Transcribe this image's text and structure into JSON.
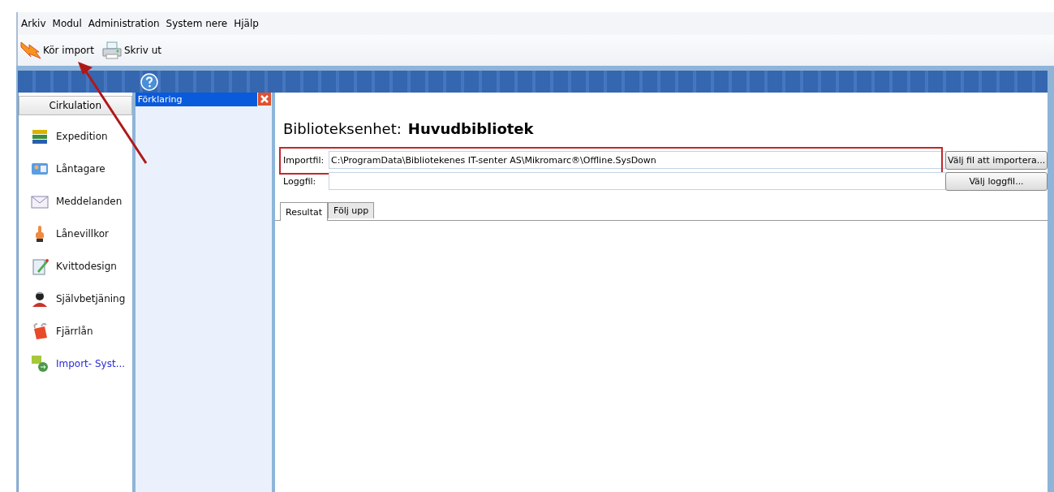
{
  "menu": [
    "Arkiv",
    "Modul",
    "Administration",
    "System nere",
    "Hjälp"
  ],
  "toolbar": [
    {
      "label": "Kör import",
      "kind": "run"
    },
    {
      "label": "Skriv ut",
      "kind": "print"
    }
  ],
  "sidebar": {
    "title": "Cirkulation",
    "items": [
      {
        "label": "Expedition",
        "kind": "books",
        "selected": false
      },
      {
        "label": "Låntagare",
        "kind": "card",
        "selected": false
      },
      {
        "label": "Meddelanden",
        "kind": "mail",
        "selected": false
      },
      {
        "label": "Lånevillkor",
        "kind": "finger",
        "selected": false
      },
      {
        "label": "Kvittodesign",
        "kind": "pen",
        "selected": false
      },
      {
        "label": "Självbetjäning",
        "kind": "person",
        "selected": false
      },
      {
        "label": "Fjärrlån",
        "kind": "bag",
        "selected": false
      },
      {
        "label": "Import- Syst...",
        "kind": "import",
        "selected": true
      }
    ]
  },
  "help_panel": {
    "title": "Förklaring"
  },
  "main": {
    "unit_label": "Biblioteksenhet:",
    "unit_value": "Huvudbibliotek",
    "fields": [
      {
        "label": "Importfil:",
        "value": "C:\\ProgramData\\Bibliotekenes IT-senter AS\\Mikromarc®\\Offline.SysDown",
        "button": "Välj fil att importera...",
        "highlighted": true
      },
      {
        "label": "Loggfil:",
        "button": "Välj loggfil...",
        "highlighted": false
      }
    ],
    "tabs": [
      {
        "label": "Resultat",
        "selected": true
      },
      {
        "label": "Följ upp",
        "selected": false
      }
    ]
  }
}
